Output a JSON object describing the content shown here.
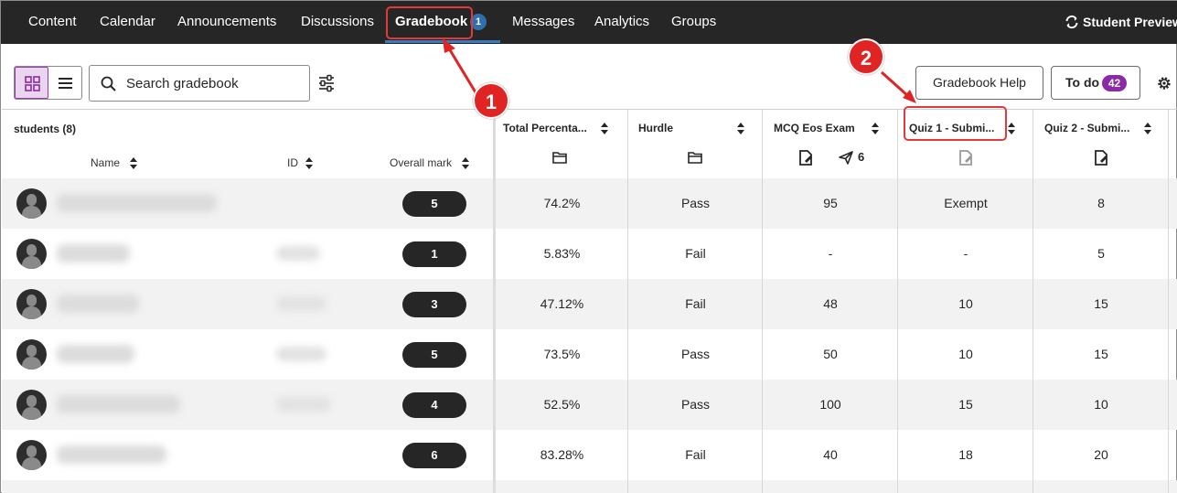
{
  "nav": {
    "items": [
      "Content",
      "Calendar",
      "Announcements",
      "Discussions",
      "Gradebook",
      "Messages",
      "Analytics",
      "Groups"
    ],
    "active_badge": "1",
    "student_preview": "Student Preview"
  },
  "annotations": {
    "one": "1",
    "two": "2"
  },
  "toolbar": {
    "search_placeholder": "Search gradebook",
    "help_label": "Gradebook Help",
    "todo_label": "To do",
    "todo_count": "42"
  },
  "grid": {
    "students_label": "students (8)",
    "name_header": "Name",
    "id_header": "ID",
    "overall_header": "Overall mark",
    "columns": [
      "Total Percenta...",
      "Hurdle",
      "MCQ Eos Exam",
      "Quiz 1 - Submi...",
      "Quiz 2 - Submi..."
    ],
    "mcq_submissions": "6",
    "rows": [
      {
        "overall": "5",
        "total": "74.2%",
        "hurdle": "Pass",
        "mcq": "95",
        "quiz1": "Exempt",
        "quiz2": "8"
      },
      {
        "overall": "1",
        "total": "5.83%",
        "hurdle": "Fail",
        "mcq": "-",
        "quiz1": "-",
        "quiz2": "5"
      },
      {
        "overall": "3",
        "total": "47.12%",
        "hurdle": "Fail",
        "mcq": "48",
        "quiz1": "10",
        "quiz2": "15"
      },
      {
        "overall": "5",
        "total": "73.5%",
        "hurdle": "Pass",
        "mcq": "50",
        "quiz1": "10",
        "quiz2": "15"
      },
      {
        "overall": "4",
        "total": "52.5%",
        "hurdle": "Pass",
        "mcq": "100",
        "quiz1": "15",
        "quiz2": "10"
      },
      {
        "overall": "6",
        "total": "83.28%",
        "hurdle": "Fail",
        "mcq": "40",
        "quiz1": "18",
        "quiz2": "20"
      }
    ]
  },
  "colors": {
    "nav_bg": "#262626",
    "accent_purple": "#8a2aa8",
    "annotation_red": "#e02424"
  }
}
